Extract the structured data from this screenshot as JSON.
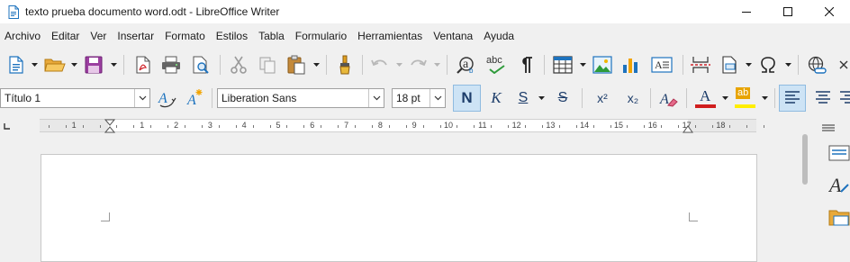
{
  "window": {
    "title": "texto prueba documento word.odt - LibreOffice Writer"
  },
  "menubar": {
    "items": [
      "Archivo",
      "Editar",
      "Ver",
      "Insertar",
      "Formato",
      "Estilos",
      "Tabla",
      "Formulario",
      "Herramientas",
      "Ventana",
      "Ayuda"
    ]
  },
  "format_toolbar": {
    "paragraph_style": "Título 1",
    "font_name": "Liberation Sans",
    "font_size": "18 pt",
    "bold_label": "N",
    "italic_label": "K",
    "underline_label": "S",
    "strike_label": "S",
    "superscript_label": "x²",
    "subscript_label": "x₂",
    "font_color_label": "A",
    "highlight_label": "ab",
    "font_color": "#d01e1e",
    "highlight_color": "#ffee00"
  },
  "standard_toolbar": {
    "spelling_label": "abc"
  },
  "ruler": {
    "labels": [
      "1",
      "1",
      "2",
      "3",
      "4",
      "5",
      "6",
      "7",
      "8",
      "9",
      "10",
      "11",
      "12",
      "13",
      "14",
      "15",
      "16",
      "17",
      "18"
    ]
  },
  "colors": {
    "accent": "#1e73be",
    "pressed_bg": "#cde3f5"
  }
}
